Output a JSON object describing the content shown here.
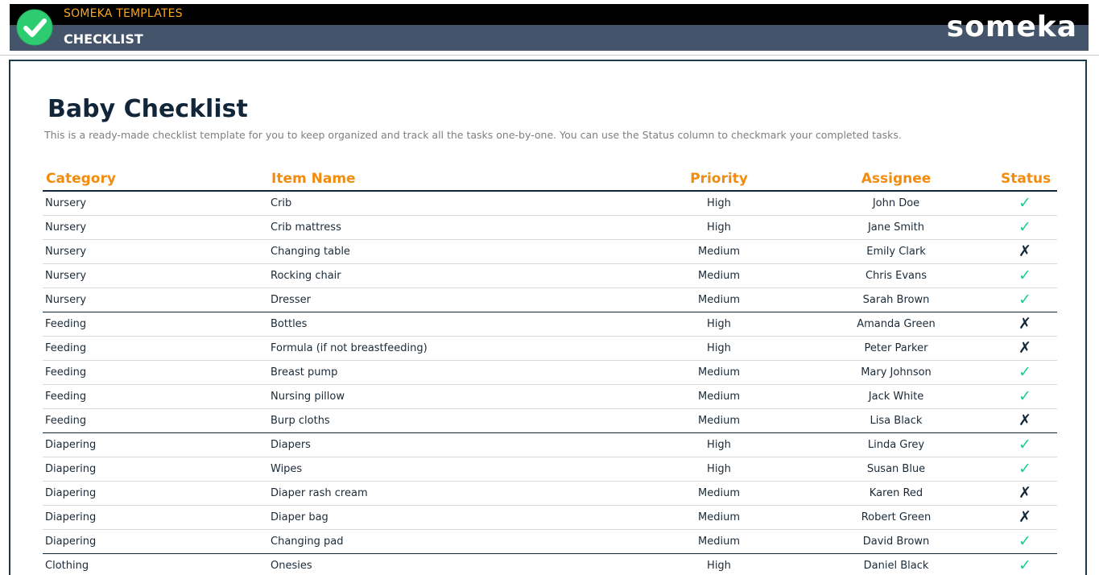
{
  "header": {
    "brand": "SOMEKA TEMPLATES",
    "page_label": "CHECKLIST",
    "logo": "someka",
    "badge_icon": "checkmark-circle-icon"
  },
  "colors": {
    "banner_top": "#000000",
    "banner_bottom": "#44546a",
    "brand_orange": "#f5a623",
    "header_orange": "#f28c0f",
    "check_green": "#1ccf8a",
    "cross_navy": "#12263a"
  },
  "main": {
    "title": "Baby Checklist",
    "subtitle": "This is a ready-made checklist template for you to keep organized and track all the tasks one-by-one. You can use the Status column to checkmark your completed tasks."
  },
  "table": {
    "columns": [
      "Category",
      "Item Name",
      "Priority",
      "Assignee",
      "Status"
    ],
    "rows": [
      {
        "category": "Nursery",
        "item": "Crib",
        "priority": "High",
        "assignee": "John Doe",
        "status": "✓"
      },
      {
        "category": "Nursery",
        "item": "Crib mattress",
        "priority": "High",
        "assignee": "Jane Smith",
        "status": "✓"
      },
      {
        "category": "Nursery",
        "item": "Changing table",
        "priority": "Medium",
        "assignee": "Emily Clark",
        "status": "✗"
      },
      {
        "category": "Nursery",
        "item": "Rocking chair",
        "priority": "Medium",
        "assignee": "Chris Evans",
        "status": "✓"
      },
      {
        "category": "Nursery",
        "item": "Dresser",
        "priority": "Medium",
        "assignee": "Sarah Brown",
        "status": "✓"
      },
      {
        "category": "Feeding",
        "item": "Bottles",
        "priority": "High",
        "assignee": "Amanda Green",
        "status": "✗"
      },
      {
        "category": "Feeding",
        "item": "Formula (if not breastfeeding)",
        "priority": "High",
        "assignee": "Peter Parker",
        "status": "✗"
      },
      {
        "category": "Feeding",
        "item": "Breast pump",
        "priority": "Medium",
        "assignee": "Mary Johnson",
        "status": "✓"
      },
      {
        "category": "Feeding",
        "item": "Nursing pillow",
        "priority": "Medium",
        "assignee": "Jack White",
        "status": "✓"
      },
      {
        "category": "Feeding",
        "item": "Burp cloths",
        "priority": "Medium",
        "assignee": "Lisa Black",
        "status": "✗"
      },
      {
        "category": "Diapering",
        "item": "Diapers",
        "priority": "High",
        "assignee": "Linda Grey",
        "status": "✓"
      },
      {
        "category": "Diapering",
        "item": "Wipes",
        "priority": "High",
        "assignee": "Susan Blue",
        "status": "✓"
      },
      {
        "category": "Diapering",
        "item": "Diaper rash cream",
        "priority": "Medium",
        "assignee": "Karen Red",
        "status": "✗"
      },
      {
        "category": "Diapering",
        "item": "Diaper bag",
        "priority": "Medium",
        "assignee": "Robert Green",
        "status": "✗"
      },
      {
        "category": "Diapering",
        "item": "Changing pad",
        "priority": "Medium",
        "assignee": "David Brown",
        "status": "✓"
      },
      {
        "category": "Clothing",
        "item": "Onesies",
        "priority": "High",
        "assignee": "Daniel Black",
        "status": "✓"
      }
    ]
  }
}
